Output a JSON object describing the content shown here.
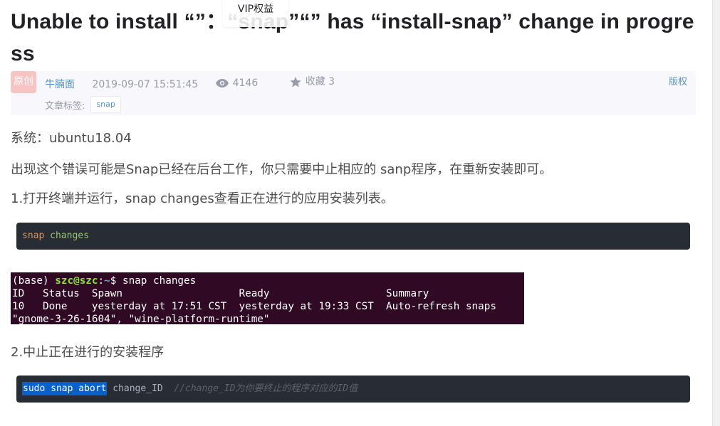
{
  "article": {
    "title": "Unable to install “”：“snap”“” has “install-snap” change in progress",
    "tooltip": "VIP权益"
  },
  "meta": {
    "badge": "原创",
    "author": "牛腩面",
    "datetime": "2019-09-07 15:51:45",
    "views": "4146",
    "favorites_label": "收藏 3",
    "copyright": "版权",
    "tags_label": "文章标签:",
    "tags": [
      "snap"
    ],
    "icons": [
      "eye-icon",
      "star-icon"
    ]
  },
  "content": {
    "system": "系统：ubuntu18.04",
    "explain": "出现这个错误可能是Snap已经在后台工作，你只需要中止相应的 sanp程序，在重新安装即可。",
    "step1": "1.打开终端并运行，snap changes查看正在进行的应用安装列表。",
    "code1": {
      "cmd": "snap",
      "arg": "changes"
    },
    "terminal": {
      "prompt_prefix": "(base) ",
      "user_host": "szc@szc",
      "colon": ":",
      "path": "~",
      "prompt_suffix": "$ snap changes",
      "header": "ID   Status  Spawn                   Ready                   Summary",
      "row": "10   Done    yesterday at 17:51 CST  yesterday at 19:33 CST  Auto-refresh snaps",
      "overflow": "\"gnome-3-26-1604\", \"wine-platform-runtime\""
    },
    "step2": "2.中止正在进行的安装程序",
    "code2": {
      "selected": "sudo snap abort",
      "arg": "change_ID",
      "comment": "//change_ID为你要终止的程序对应的ID值"
    }
  },
  "colors": {
    "code_bg": "#282c34",
    "terminal_bg": "#300a24",
    "link": "#5893c2",
    "badge_bg": "#f8c3c3"
  }
}
